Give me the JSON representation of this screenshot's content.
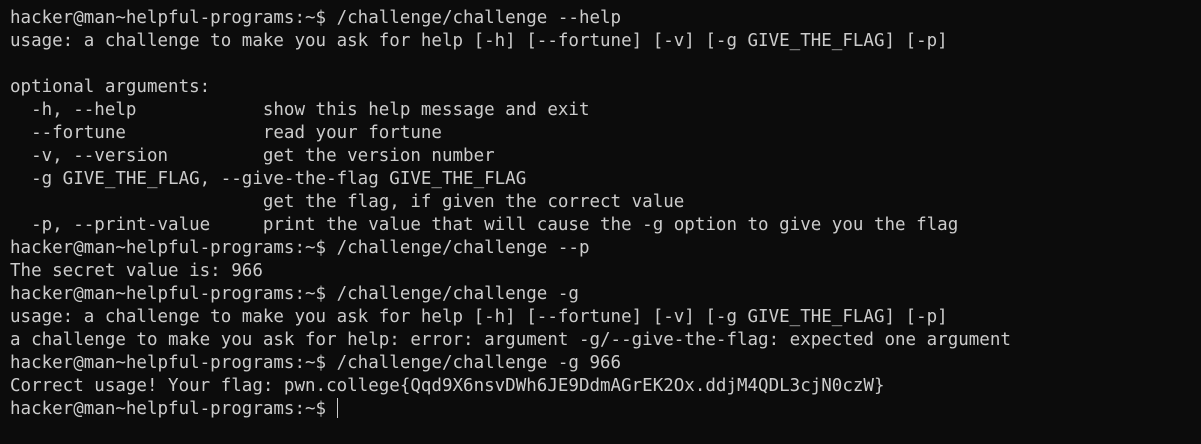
{
  "terminal": {
    "lines": [
      "hacker@man~helpful-programs:~$ /challenge/challenge --help",
      "usage: a challenge to make you ask for help [-h] [--fortune] [-v] [-g GIVE_THE_FLAG] [-p]",
      "",
      "optional arguments:",
      "  -h, --help            show this help message and exit",
      "  --fortune             read your fortune",
      "  -v, --version         get the version number",
      "  -g GIVE_THE_FLAG, --give-the-flag GIVE_THE_FLAG",
      "                        get the flag, if given the correct value",
      "  -p, --print-value     print the value that will cause the -g option to give you the flag",
      "hacker@man~helpful-programs:~$ /challenge/challenge --p",
      "The secret value is: 966",
      "hacker@man~helpful-programs:~$ /challenge/challenge -g",
      "usage: a challenge to make you ask for help [-h] [--fortune] [-v] [-g GIVE_THE_FLAG] [-p]",
      "a challenge to make you ask for help: error: argument -g/--give-the-flag: expected one argument",
      "hacker@man~helpful-programs:~$ /challenge/challenge -g 966",
      "Correct usage! Your flag: pwn.college{Qqd9X6nsvDWh6JE9DdmAGrEK2Ox.ddjM4QDL3cjN0czW}",
      "hacker@man~helpful-programs:~$ "
    ]
  }
}
